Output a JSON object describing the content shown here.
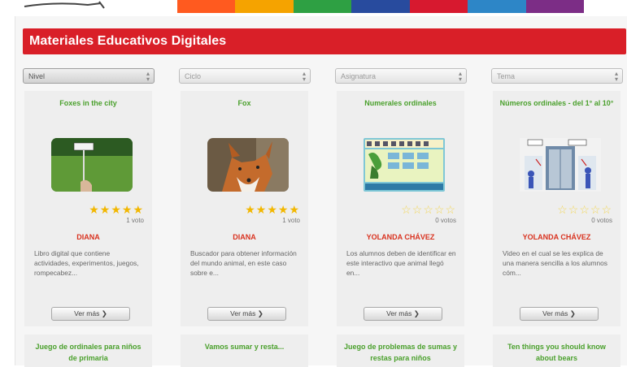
{
  "colors": {
    "header_red": "#d91f28",
    "title_green": "#4aa02c",
    "author_red": "#d9321f",
    "top_bar": [
      "#ff5a1f",
      "#f5a300",
      "#2ea043",
      "#284b9e",
      "#d7192f",
      "#2d86c7",
      "#7c2d86"
    ]
  },
  "section": {
    "title": "Materiales Educativos Digitales"
  },
  "filters": [
    {
      "label": "Nivel",
      "active": true
    },
    {
      "label": "Ciclo",
      "active": false
    },
    {
      "label": "Asignatura",
      "active": false
    },
    {
      "label": "Tema",
      "active": false
    }
  ],
  "cards": [
    {
      "title": "Foxes in the city",
      "image": "field-sign-image",
      "rating": 5,
      "votes": "1 voto",
      "author": "DIANA",
      "description": "Libro digital que contiene actividades, experimentos, juegos, rompecabez...",
      "button": "Ver más ❯"
    },
    {
      "title": "Fox",
      "image": "fox-image",
      "rating": 5,
      "votes": "1 voto",
      "author": "DIANA",
      "description": "Buscador para obtener información del mundo animal, en este caso sobre e...",
      "button": "Ver más ❯"
    },
    {
      "title": "Numerales ordinales",
      "image": "ordinal-numbers-game-image",
      "rating": 0,
      "votes": "0 votos",
      "author": "YOLANDA CHÁVEZ",
      "description": "Los alumnos deben de identificar en este interactivo que animal llegó en...",
      "button": "Ver más ❯"
    },
    {
      "title": "Números ordinales - del 1° al 10°",
      "image": "elevator-floors-image",
      "rating": 0,
      "votes": "0 votos",
      "author": "YOLANDA CHÁVEZ",
      "description": "Video en el cual se les explica de una manera sencilla a los alumnos cóm...",
      "button": "Ver más ❯"
    }
  ],
  "next_row": [
    {
      "title": "Juego de ordinales para niños de primaria"
    },
    {
      "title": "Vamos sumar y resta..."
    },
    {
      "title": "Juego de problemas de sumas y restas para niños"
    },
    {
      "title": "Ten things you should know about bears"
    }
  ]
}
